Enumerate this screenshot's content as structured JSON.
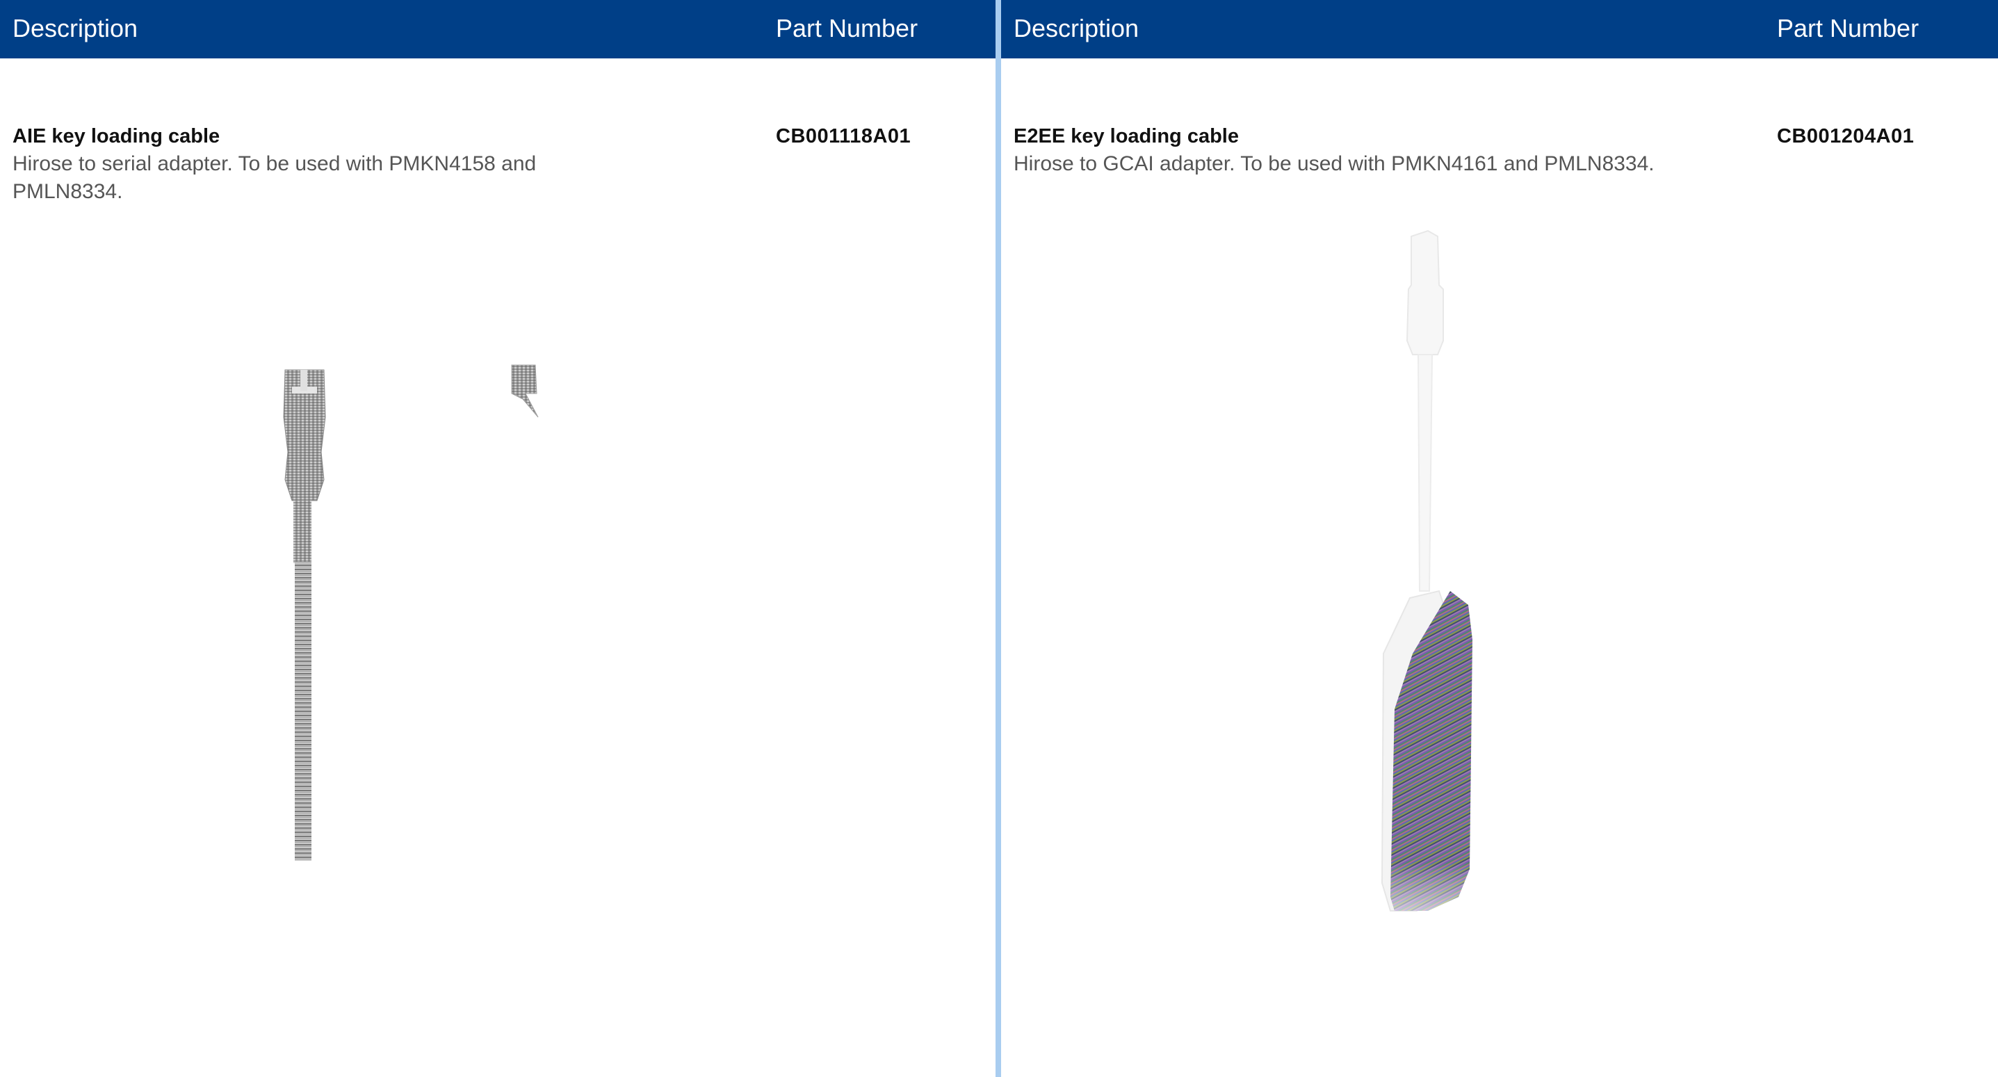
{
  "left": {
    "header": {
      "description_label": "Description",
      "part_number_label": "Part Number"
    },
    "item": {
      "title": "AIE key loading cable",
      "description": "Hirose to serial adapter. To be used with PMKN4158 and PMLN8334.",
      "part_number": "CB001118A01",
      "image_icon": "cable-product-image"
    }
  },
  "right": {
    "header": {
      "description_label": "Description",
      "part_number_label": "Part Number"
    },
    "item": {
      "title": "E2EE key loading cable",
      "description": "Hirose to GCAI adapter. To be used with PMKN4161 and PMLN8334.",
      "part_number": "CB001204A01",
      "image_icon": "cable-product-image"
    }
  },
  "colors": {
    "header_bg": "#003f87",
    "header_text": "#ffffff",
    "divider": "#a9cdf0",
    "title_text": "#111111",
    "body_text": "#555555"
  }
}
